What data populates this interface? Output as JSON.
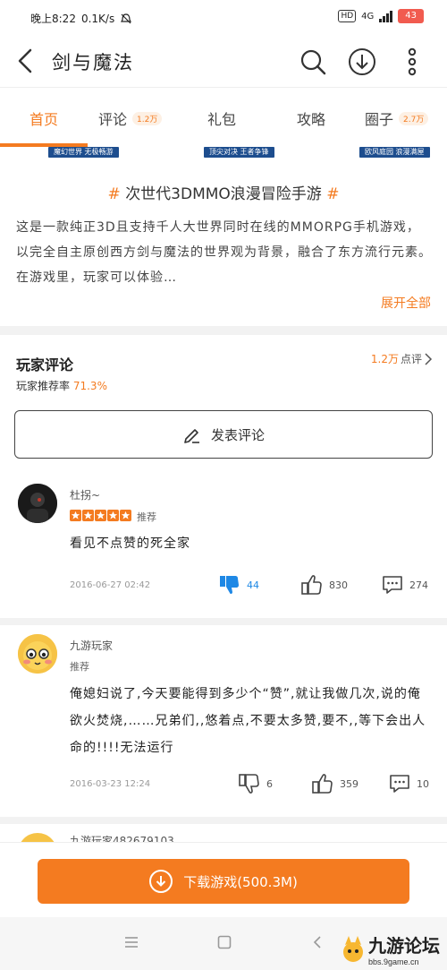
{
  "status_bar": {
    "time": "晚上8:22",
    "speed": "0.1K/s",
    "hd": "HD",
    "net": "4G",
    "battery": "43"
  },
  "header": {
    "title": "剑与魔法",
    "back_icon": "chevron-left-icon",
    "search_icon": "search-icon",
    "download_icon": "download-circle-icon",
    "more_icon": "more-vertical-icon"
  },
  "tabs": [
    {
      "label": "首页",
      "count": ""
    },
    {
      "label": "评论",
      "count": "1.2万"
    },
    {
      "label": "礼包",
      "count": ""
    },
    {
      "label": "攻略",
      "count": ""
    },
    {
      "label": "圈子",
      "count": "2.7万"
    }
  ],
  "active_tab": "首页",
  "banners": [
    "魔幻世界 无极畅游",
    "顶尖对决 王者争锋",
    "欧风庭园 浪漫满屋"
  ],
  "intro": {
    "hash": "#",
    "title": "次世代3DMMO浪漫冒险手游",
    "text": "这是一款纯正3D且支持千人大世界同时在线的MMORPG手机游戏，以完全自主原创西方剑与魔法的世界观为背景，融合了东方流行元素。在游戏里，玩家可以体验…",
    "expand": "展开全部"
  },
  "reviews": {
    "title": "玩家评论",
    "count": "1.2万",
    "count_suffix": "点评",
    "rate_label": "玩家推荐率",
    "rate": "71.3%",
    "post_label": "发表评论"
  },
  "comments": [
    {
      "user": "杜拐~",
      "tag": "推荐",
      "stars": 5,
      "text": "看见不点赞的死全家",
      "date": "2016-06-27 02:42",
      "dislikes": "44",
      "likes": "830",
      "replies": "274"
    },
    {
      "user": "九游玩家",
      "tag": "推荐",
      "text": "俺媳妇说了,今天要能得到多少个“赞”,就让我做几次,说的俺欲火焚烧,……兄弟们,,悠着点,不要太多赞,要不,,等下会出人命的!!!!无法运行",
      "date": "2016-03-23 12:24",
      "dislikes": "6",
      "likes": "359",
      "replies": "10"
    },
    {
      "user": "九游玩家482679103"
    }
  ],
  "download": {
    "label": "下载游戏(500.3M)"
  },
  "watermark": {
    "name": "九游论坛",
    "url": "bbs.9game.cn"
  },
  "colors": {
    "accent": "#f47b20",
    "active_dislike": "#1e88e5"
  }
}
